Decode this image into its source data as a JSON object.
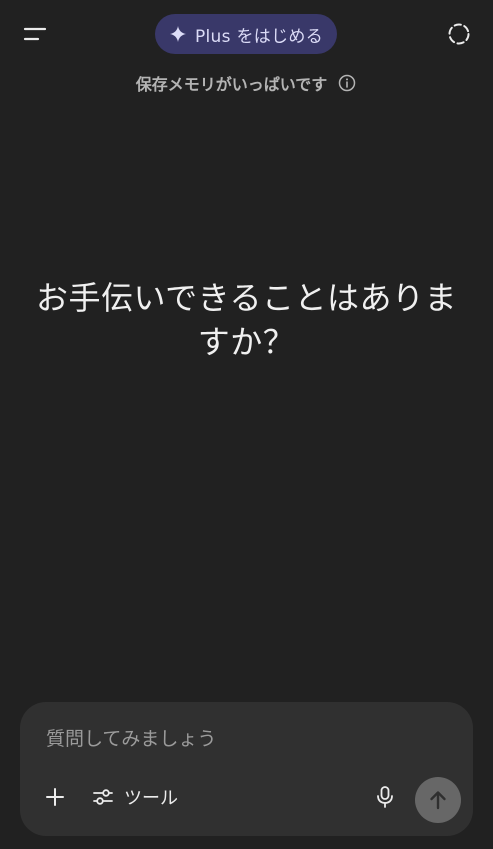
{
  "header": {
    "menu_icon": "menu-icon",
    "upgrade_pill": {
      "icon": "sparkle-icon",
      "label": "Plus をはじめる"
    },
    "temporary_chat_icon": "dashed-circle-icon"
  },
  "memory_notice": {
    "text": "保存メモリがいっぱいです",
    "icon": "info-icon"
  },
  "greeting": {
    "line1": "お手伝いできることはありま",
    "line2": "すか？"
  },
  "composer": {
    "placeholder": "質問してみましょう",
    "value": "",
    "add_icon": "plus-icon",
    "tools": {
      "icon": "sliders-icon",
      "label": "ツール"
    },
    "mic_icon": "microphone-icon",
    "send_icon": "arrow-up-icon"
  },
  "colors": {
    "background": "#212121",
    "pill_background": "#393869",
    "composer_background": "#303030",
    "send_button": "#676767"
  }
}
